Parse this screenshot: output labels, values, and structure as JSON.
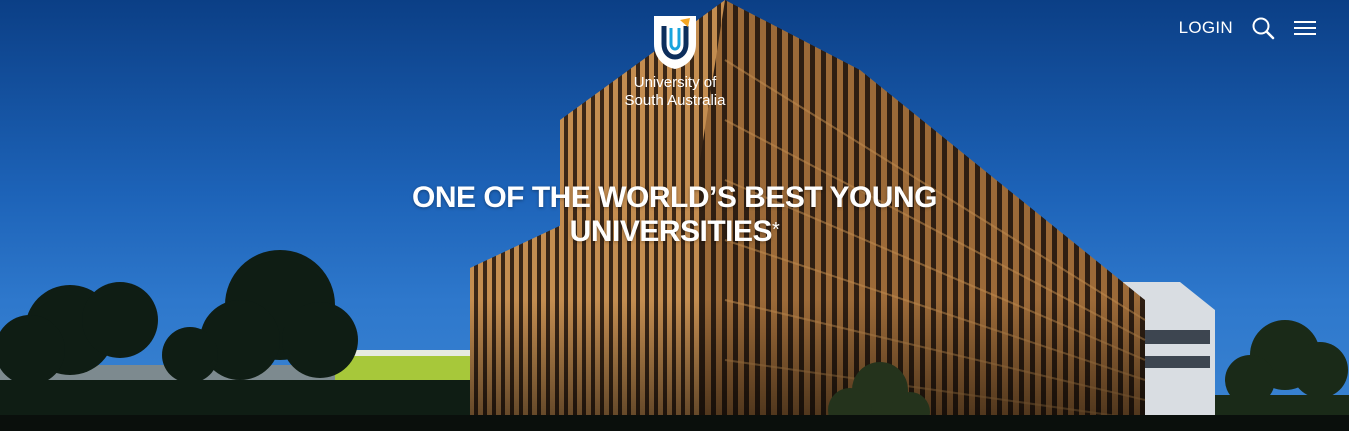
{
  "header": {
    "logo_line1": "University of",
    "logo_line2": "South Australia",
    "login_label": "LOGIN",
    "search_icon": "search-icon",
    "menu_icon": "hamburger-menu-icon"
  },
  "hero": {
    "headline_line1": "ONE OF THE WORLD’S BEST YOUNG",
    "headline_line2": "UNIVERSITIES",
    "headline_mark": "*"
  },
  "colors": {
    "sky_top": "#0b3f86",
    "sky_bottom": "#3b84d2",
    "timber": "#b9844a",
    "white": "#ffffff"
  }
}
